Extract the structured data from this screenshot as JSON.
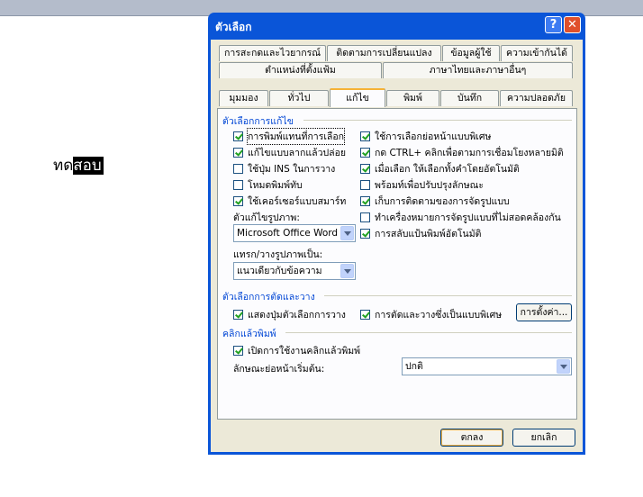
{
  "side_text": {
    "prefix": "ทด",
    "highlight": "สอบ"
  },
  "dialog": {
    "title": "ตัวเลือก",
    "help_label": "?",
    "close_label": "✕"
  },
  "tabs": {
    "row1": [
      "การสะกดและไวยากรณ์",
      "ติดตามการเปลี่ยนแปลง",
      "ข้อมูลผู้ใช้",
      "ความเข้ากันได้"
    ],
    "row2": [
      "ตำแหน่งที่ตั้งแฟ้ม",
      "ภาษาไทยและภาษาอื่นๆ"
    ],
    "row3": [
      "มุมมอง",
      "ทั่วไป",
      "แก้ไข",
      "พิมพ์",
      "บันทึก",
      "ความปลอดภัย"
    ],
    "active": "แก้ไข"
  },
  "edit_options": {
    "group_label": "ตัวเลือกการแก้ไข",
    "left": [
      {
        "label": "การพิมพ์แทนที่การเลือก",
        "checked": true
      },
      {
        "label": "แก้ไขแบบลากแล้วปล่อย",
        "checked": true
      },
      {
        "label": "ใช้ปุ่ม INS ในการวาง",
        "checked": false
      },
      {
        "label": "โหมดพิมพ์ทับ",
        "checked": false
      },
      {
        "label": "ใช้เคอร์เซอร์แบบสมาร์ท",
        "checked": true
      }
    ],
    "right": [
      {
        "label": "ใช้การเลือกย่อหน้าแบบพิเศษ",
        "checked": true
      },
      {
        "label": "กด CTRL+ คลิกเพื่อตามการเชื่อมโยงหลายมิติ",
        "checked": true
      },
      {
        "label": "เมื่อเลือก ให้เลือกทั้งคำโดยอัตโนมัติ",
        "checked": true
      },
      {
        "label": "พร้อมท์เพื่อปรับปรุงลักษณะ",
        "checked": false
      },
      {
        "label": "เก็บการติดตามของการจัดรูปแบบ",
        "checked": true
      },
      {
        "label": "ทำเครื่องหมายการจัดรูปแบบที่ไม่สอดคล้องกัน",
        "checked": false
      },
      {
        "label": "การสลับแป้นพิมพ์อัตโนมัติ",
        "checked": true
      }
    ],
    "picture_editor_label": "ตัวแก้ไขรูปภาพ:",
    "picture_editor_value": "Microsoft Office Word",
    "insert_as_label": "แทรก/วางรูปภาพเป็น:",
    "insert_as_value": "แนวเดียวกับข้อความ"
  },
  "cut_paste": {
    "group_label": "ตัวเลือกการตัดและวาง",
    "show_paste_options": {
      "label": "แสดงปุ่มตัวเลือกการวาง",
      "checked": true
    },
    "smart_cut_paste": {
      "label": "การตัดและวางซึ่งเป็นแบบพิเศษ",
      "checked": true
    },
    "settings_button": "การตั้งค่า..."
  },
  "click_type": {
    "group_label": "คลิกแล้วพิมพ์",
    "enable": {
      "label": "เปิดการใช้งานคลิกแล้วพิมพ์",
      "checked": true
    },
    "default_style_label": "ลักษณะย่อหน้าเริ่มต้น:",
    "default_style_value": "ปกติ"
  },
  "footer": {
    "ok": "ตกลง",
    "cancel": "ยกเลิก"
  },
  "colors": {
    "title_bar": "#0a55d8",
    "group_text": "#0046d5",
    "dialog_face": "#ece9d8"
  }
}
